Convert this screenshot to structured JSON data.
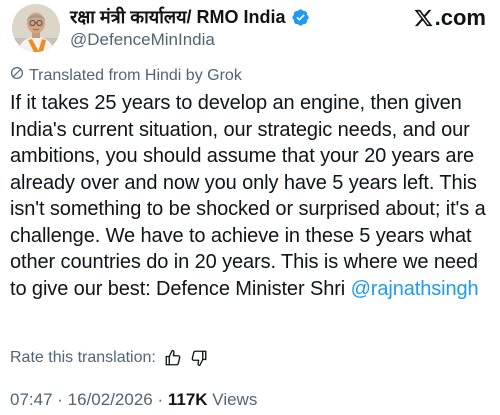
{
  "author": {
    "display_name": "रक्षा मंत्री कार्यालय/ RMO India",
    "handle": "@DefenceMinIndia",
    "verified": true
  },
  "brand": {
    "logo_text": ".com"
  },
  "translation": {
    "label": "Translated from Hindi by Grok"
  },
  "tweet": {
    "text": "If it takes 25 years to develop an engine, then given India's current situation, our strategic needs, and our ambitions, you should assume that your 20 years are already over and now you only have 5 years left. This isn't something to be shocked or surprised about; it's a challenge. We have to achieve in these 5 years what other countries do in 20 years. This is where we need to give our best: Defence Minister Shri ",
    "mention": "@rajnathsingh"
  },
  "rating": {
    "label": "Rate this translation:"
  },
  "meta": {
    "time": "07:47",
    "separator": " · ",
    "date": "16/02/2026",
    "views_count": "117K",
    "views_label": "Views"
  },
  "colors": {
    "text": "#0f1419",
    "secondary": "#536471",
    "link": "#1d9bf0",
    "verified": "#1d9bf0"
  },
  "icons": {
    "verified": "verified-badge-icon",
    "logo": "x-logo-icon",
    "translate": "grok-icon",
    "thumbs_up": "thumbs-up-icon",
    "thumbs_down": "thumbs-down-icon"
  }
}
